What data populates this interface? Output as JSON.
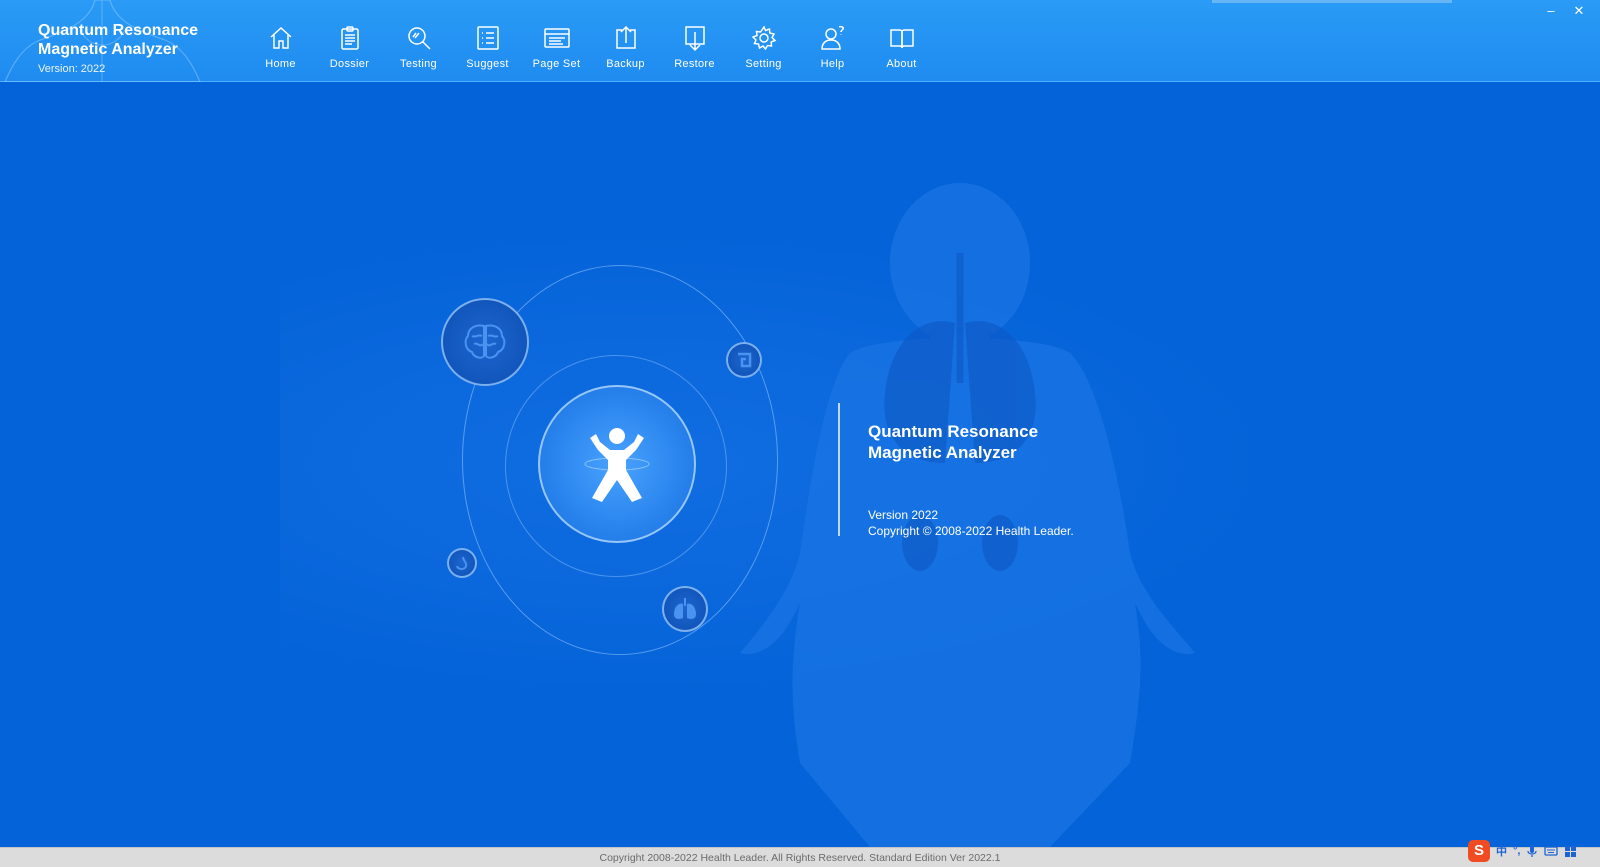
{
  "app": {
    "title_line1": "Quantum Resonance",
    "title_line2": "Magnetic Analyzer",
    "version_label": "Version: 2022"
  },
  "toolbar": {
    "items": [
      {
        "label": "Home",
        "icon": "home-icon"
      },
      {
        "label": "Dossier",
        "icon": "clipboard-icon"
      },
      {
        "label": "Testing",
        "icon": "magnifier-icon"
      },
      {
        "label": "Suggest",
        "icon": "list-icon"
      },
      {
        "label": "Page Set",
        "icon": "page-layout-icon"
      },
      {
        "label": "Backup",
        "icon": "upload-icon"
      },
      {
        "label": "Restore",
        "icon": "download-icon"
      },
      {
        "label": "Setting",
        "icon": "gear-icon"
      },
      {
        "label": "Help",
        "icon": "user-question-icon"
      },
      {
        "label": "About",
        "icon": "book-icon"
      }
    ]
  },
  "window": {
    "minimize": "–",
    "close": "✕"
  },
  "splash": {
    "title_line1": "Quantum Resonance",
    "title_line2": "Magnetic Analyzer",
    "version": "Version 2022",
    "copyright": "Copyright © 2008-2022 Health Leader."
  },
  "status": {
    "text": "Copyright 2008-2022 Health Leader. All Rights Reserved.  Standard Edition Ver 2022.1"
  },
  "ime": {
    "logo": "S",
    "lang": "中",
    "punct": "°,",
    "mic": "mic-icon",
    "keyboard": "keyboard-icon",
    "grid": "grid-icon"
  },
  "colors": {
    "header": "#1f8bf0",
    "background": "#0563d9",
    "statusbar": "#dcdcdc",
    "ime_accent": "#f04b23"
  }
}
